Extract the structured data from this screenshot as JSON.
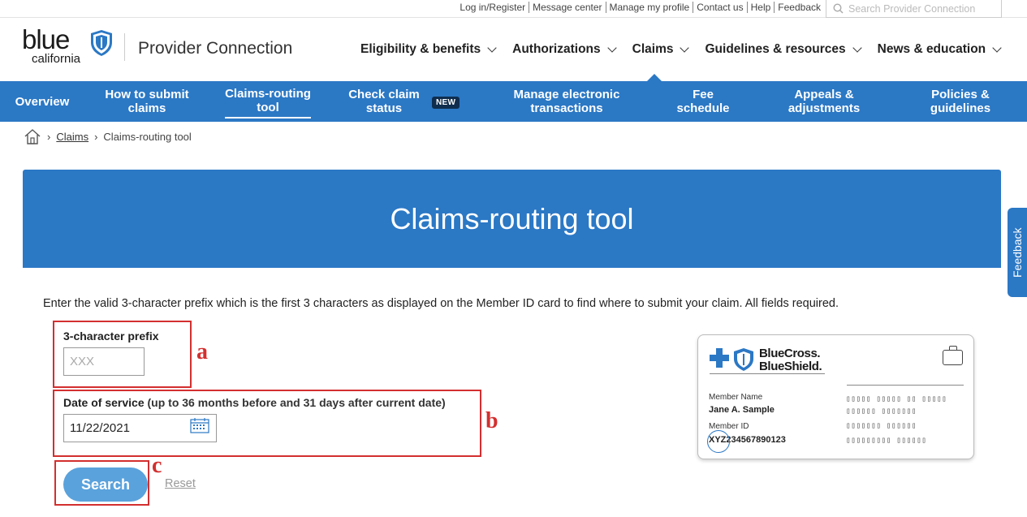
{
  "utility": {
    "links": [
      "Log in/Register",
      "Message center",
      "Manage my profile",
      "Contact us",
      "Help",
      "Feedback"
    ],
    "search_placeholder": "Search Provider Connection"
  },
  "header": {
    "logo_word": "blue",
    "logo_sub": "california",
    "brand": "Provider Connection",
    "nav": [
      "Eligibility & benefits",
      "Authorizations",
      "Claims",
      "Guidelines & resources",
      "News & education"
    ]
  },
  "subnav": {
    "items": [
      "Overview",
      "How to submit claims",
      "Claims-routing tool",
      "Check claim status",
      "Manage electronic transactions",
      "Fee schedule",
      "Appeals & adjustments",
      "Policies & guidelines"
    ],
    "new_badge": "NEW"
  },
  "breadcrumb": {
    "link": "Claims",
    "current": "Claims-routing tool"
  },
  "page": {
    "title": "Claims-routing tool",
    "instructions": "Enter the valid 3-character prefix which is the first 3 characters as displayed on the Member ID card to find where to submit your claim. All fields required."
  },
  "form": {
    "prefix_label": "3-character prefix",
    "prefix_placeholder": "XXX",
    "date_label": "Date of service",
    "date_hint": "(up to 36 months before and 31 days after current date)",
    "date_value": "11/22/2021",
    "search_label": "Search",
    "reset_label": "Reset"
  },
  "annotations": [
    "a",
    "b",
    "c"
  ],
  "id_card": {
    "brand_line1": "BlueCross.",
    "brand_line2": "BlueShield.",
    "member_name_label": "Member Name",
    "member_name": "Jane A. Sample",
    "member_id_label": "Member ID",
    "member_id": "XYZ234567890123",
    "garbled_lines": [
      "▯▯▯▯▯ ▯▯▯▯▯ ▯▯ ▯▯▯▯▯",
      "▯▯▯▯▯▯ ▯▯▯▯▯▯▯",
      "▯▯▯▯▯▯▯ ▯▯▯▯▯▯",
      "▯▯▯▯▯▯▯▯▯ ▯▯▯▯▯▯"
    ]
  },
  "feedback_tab": "Feedback",
  "colors": {
    "primary": "#2b78c5",
    "button": "#5aa2dc",
    "annotation": "#d32f2f"
  }
}
